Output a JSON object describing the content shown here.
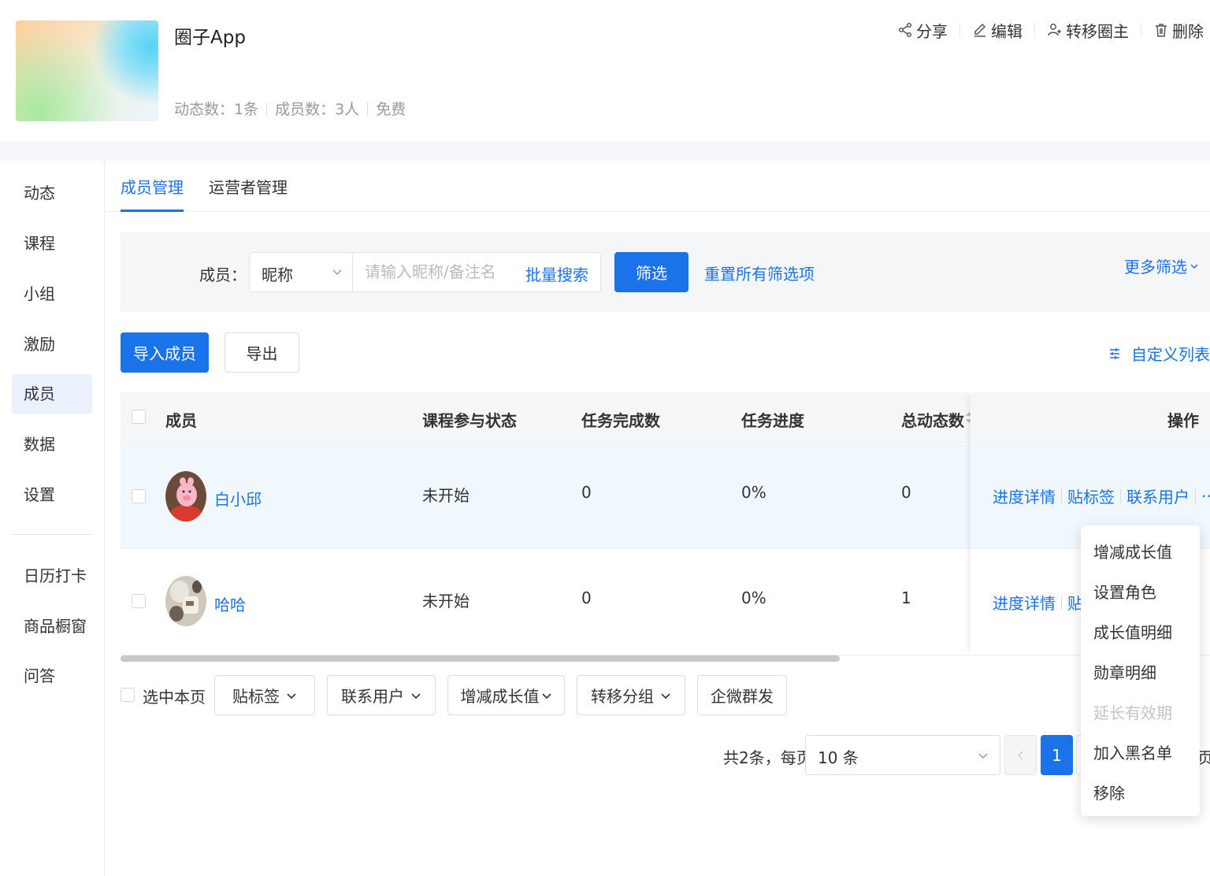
{
  "header": {
    "title": "圈子App",
    "stats": [
      "动态数：1条",
      "成员数：3人",
      "免费"
    ],
    "actions": [
      "分享",
      "编辑",
      "转移圈主",
      "删除"
    ]
  },
  "sidebar": {
    "items": [
      "动态",
      "课程",
      "小组",
      "激励",
      "成员",
      "数据",
      "设置"
    ],
    "extra_items": [
      "日历打卡",
      "商品橱窗",
      "问答"
    ],
    "active": "成员"
  },
  "tabs": [
    "成员管理",
    "运营者管理"
  ],
  "filter": {
    "label": "成员：",
    "select_value": "昵称",
    "search_placeholder": "请输入昵称/备注名",
    "batch_search": "批量搜索",
    "filter_button": "筛选",
    "reset": "重置所有筛选项",
    "more": "更多筛选"
  },
  "toolbar": {
    "import": "导入成员",
    "export": "导出",
    "custom_list": "自定义列表"
  },
  "table": {
    "headers": [
      "成员",
      "课程参与状态",
      "任务完成数",
      "任务进度",
      "总动态数",
      "操作"
    ],
    "rows": [
      {
        "name": "白小邱",
        "course_status": "未开始",
        "tasks_done": "0",
        "progress": "0%",
        "posts": "0"
      },
      {
        "name": "哈哈",
        "course_status": "未开始",
        "tasks_done": "0",
        "progress": "0%",
        "posts": "1"
      }
    ],
    "row_actions": [
      "进度详情",
      "贴标签",
      "联系用户",
      "···"
    ],
    "row2_actions": [
      "进度详情",
      "贴"
    ]
  },
  "batch": {
    "select_page": "选中本页",
    "buttons": [
      "贴标签",
      "联系用户",
      "增减成长值",
      "转移分组",
      "企微群发"
    ]
  },
  "pagination": {
    "total": "共2条，每页",
    "page_size": "10 条",
    "current_page": "1",
    "suffix": "页"
  },
  "dropdown_menu": {
    "items": [
      "增减成长值",
      "设置角色",
      "成长值明细",
      "勋章明细",
      "延长有效期",
      "加入黑名单",
      "移除"
    ],
    "disabled": [
      "延长有效期"
    ]
  },
  "colors": {
    "primary": "#1a73e8",
    "row_hover": "#f0f7fd",
    "panel_bg": "#f5f6f8"
  }
}
